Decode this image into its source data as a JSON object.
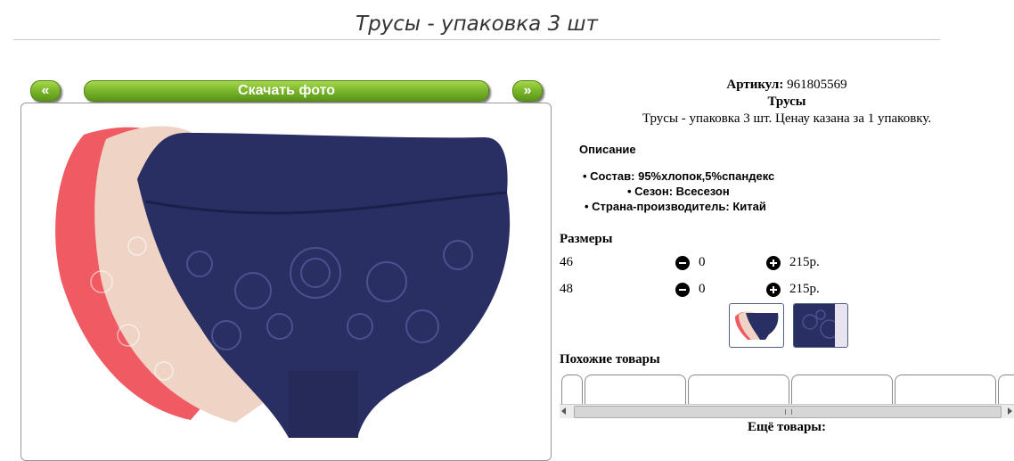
{
  "page": {
    "title": "Трусы - упаковка 3 шт"
  },
  "gallery": {
    "prev_label": "«",
    "download_label": "Скачать фото",
    "next_label": "»"
  },
  "product": {
    "article_label": "Артикул:",
    "article_value": "961805569",
    "category": "Трусы",
    "short_desc": "Трусы - упаковка 3 шт. Ценау казана за 1 упаковку.",
    "description_heading": "Описание",
    "details": [
      "Состав: 95%хлопок,5%спандекс",
      "Сезон: Всесезон",
      "Страна-производитель: Китай"
    ]
  },
  "sizes": {
    "heading": "Размеры",
    "rows": [
      {
        "size": "46",
        "qty": "0",
        "price": "215р."
      },
      {
        "size": "48",
        "qty": "0",
        "price": "215р."
      }
    ]
  },
  "similar": {
    "heading": "Похожие товары",
    "more_heading": "Ещё товары:"
  },
  "colors": {
    "navy": "#2a2f63",
    "pink": "#f05a63",
    "beige": "#efd4c6",
    "button_green": "#6fae25"
  }
}
